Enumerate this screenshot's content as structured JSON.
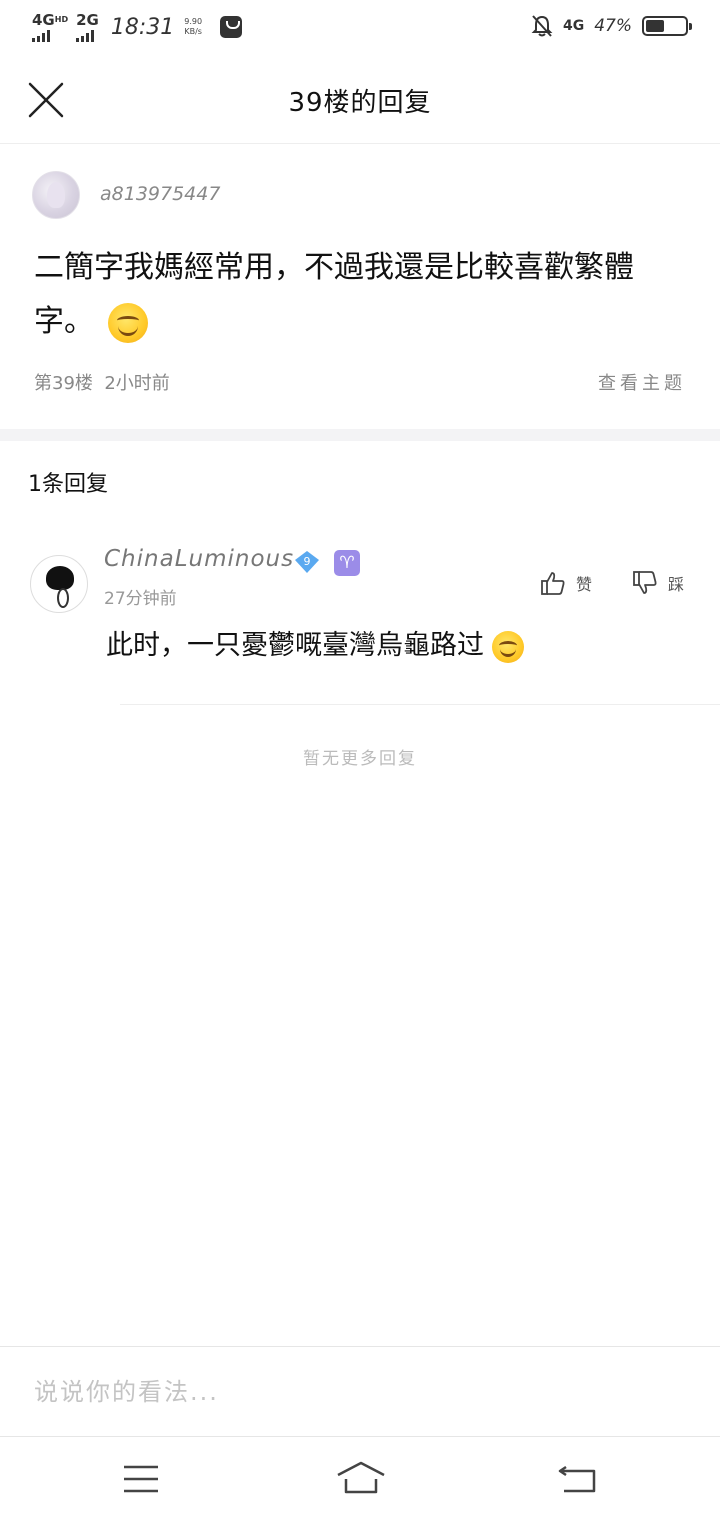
{
  "status_bar": {
    "network1": "4G",
    "network1_sup": "HD",
    "network2": "2G",
    "time": "18:31",
    "speed_value": "9.90",
    "speed_unit": "KB/s",
    "network3": "4G",
    "battery_percent": "47%",
    "battery_level": 0.47
  },
  "header": {
    "title": "39楼的回复"
  },
  "post": {
    "username": "a813975447",
    "content": "二簡字我媽經常用，不過我還是比較喜歡繁體字。",
    "floor": "第39楼",
    "time": "2小时前",
    "view_topic": "查看主题"
  },
  "replies_section": {
    "count_label": "1条回复",
    "replies": [
      {
        "username": "ChinaLuminous",
        "level": "9",
        "zodiac": "♈",
        "time": "27分钟前",
        "content": "此时，一只憂鬱嘅臺灣烏龜路过",
        "like_label": "赞",
        "dislike_label": "踩"
      }
    ],
    "no_more": "暂无更多回复"
  },
  "comment_bar": {
    "placeholder": "说说你的看法..."
  },
  "colors": {
    "badge_blue": "#5aa9f0",
    "badge_purple": "#9b8ce8"
  }
}
